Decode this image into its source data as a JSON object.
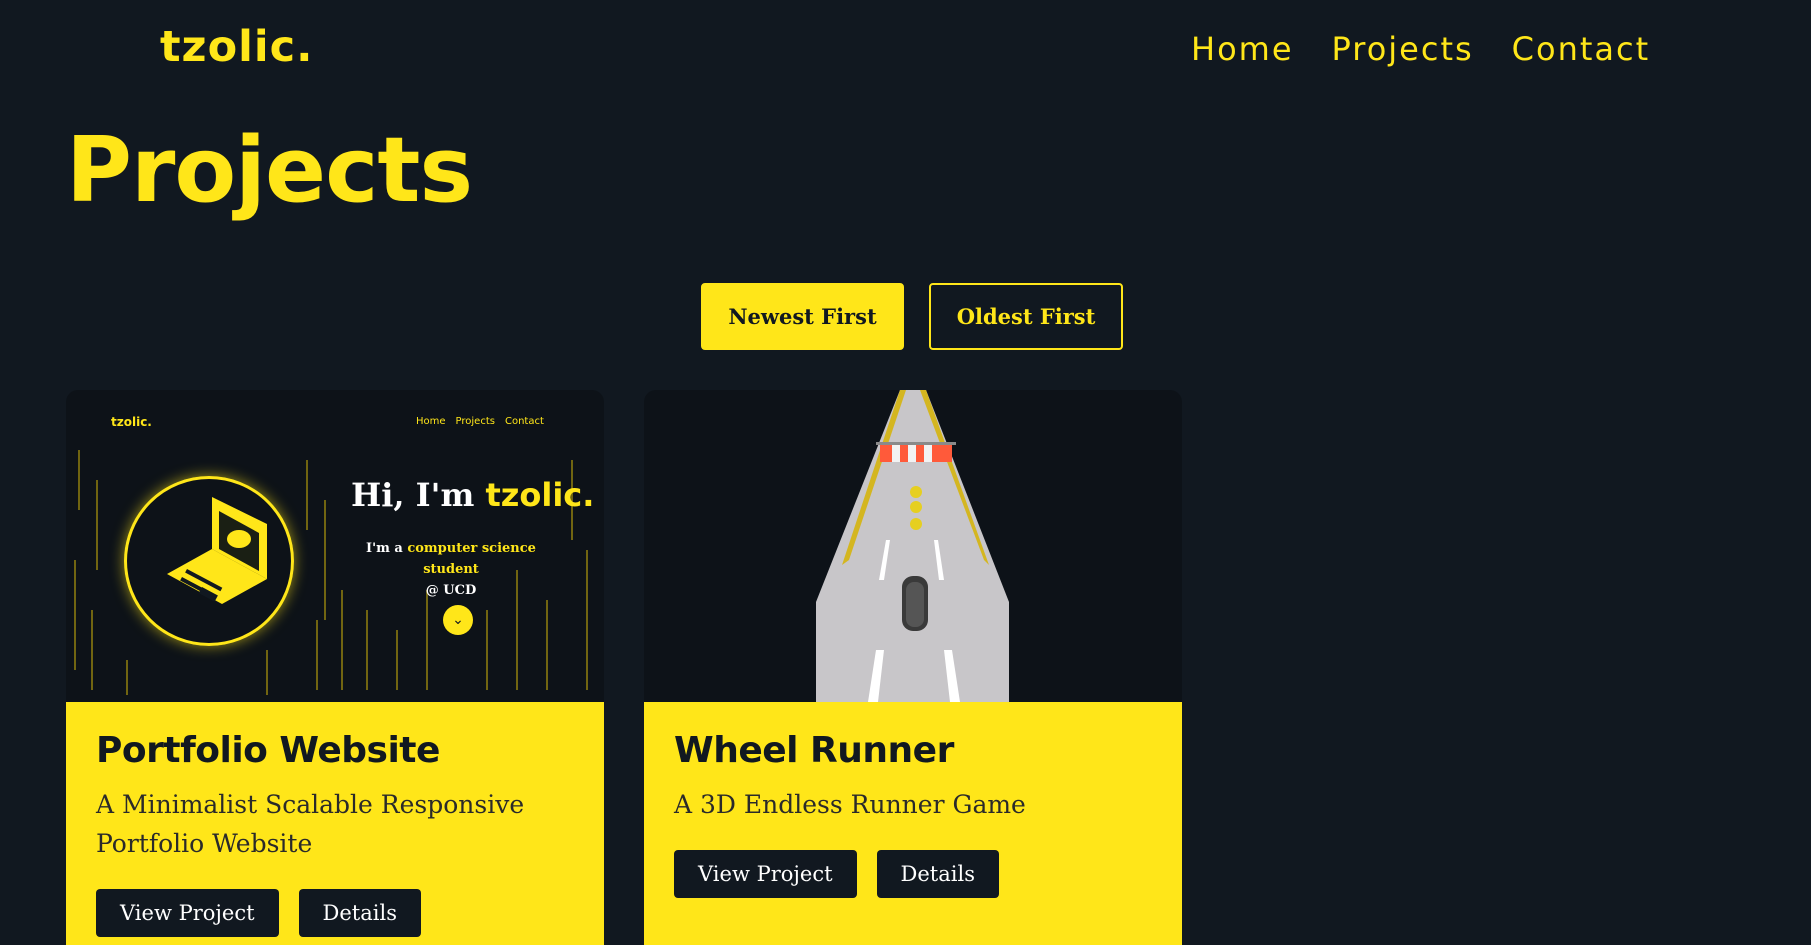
{
  "header": {
    "logo": "tzolic.",
    "nav": [
      "Home",
      "Projects",
      "Contact"
    ]
  },
  "page_title": "Projects",
  "sort": {
    "newest": "Newest First",
    "oldest": "Oldest First"
  },
  "projects": [
    {
      "title": "Portfolio Website",
      "description": "A Minimalist Scalable Responsive Portfolio Website",
      "view_label": "View Project",
      "details_label": "Details",
      "thumb": {
        "logo": "tzolic.",
        "nav": [
          "Home",
          "Projects",
          "Contact"
        ],
        "greeting": "Hi, I'm ",
        "greeting_name": "tzolic.",
        "sub_prefix": "I'm a ",
        "sub_highlight": "computer science student",
        "sub_suffix": "@ UCD"
      }
    },
    {
      "title": "Wheel Runner",
      "description": "A 3D Endless Runner Game",
      "view_label": "View Project",
      "details_label": "Details"
    }
  ],
  "colors": {
    "accent": "#ffe619",
    "background": "#111820"
  }
}
